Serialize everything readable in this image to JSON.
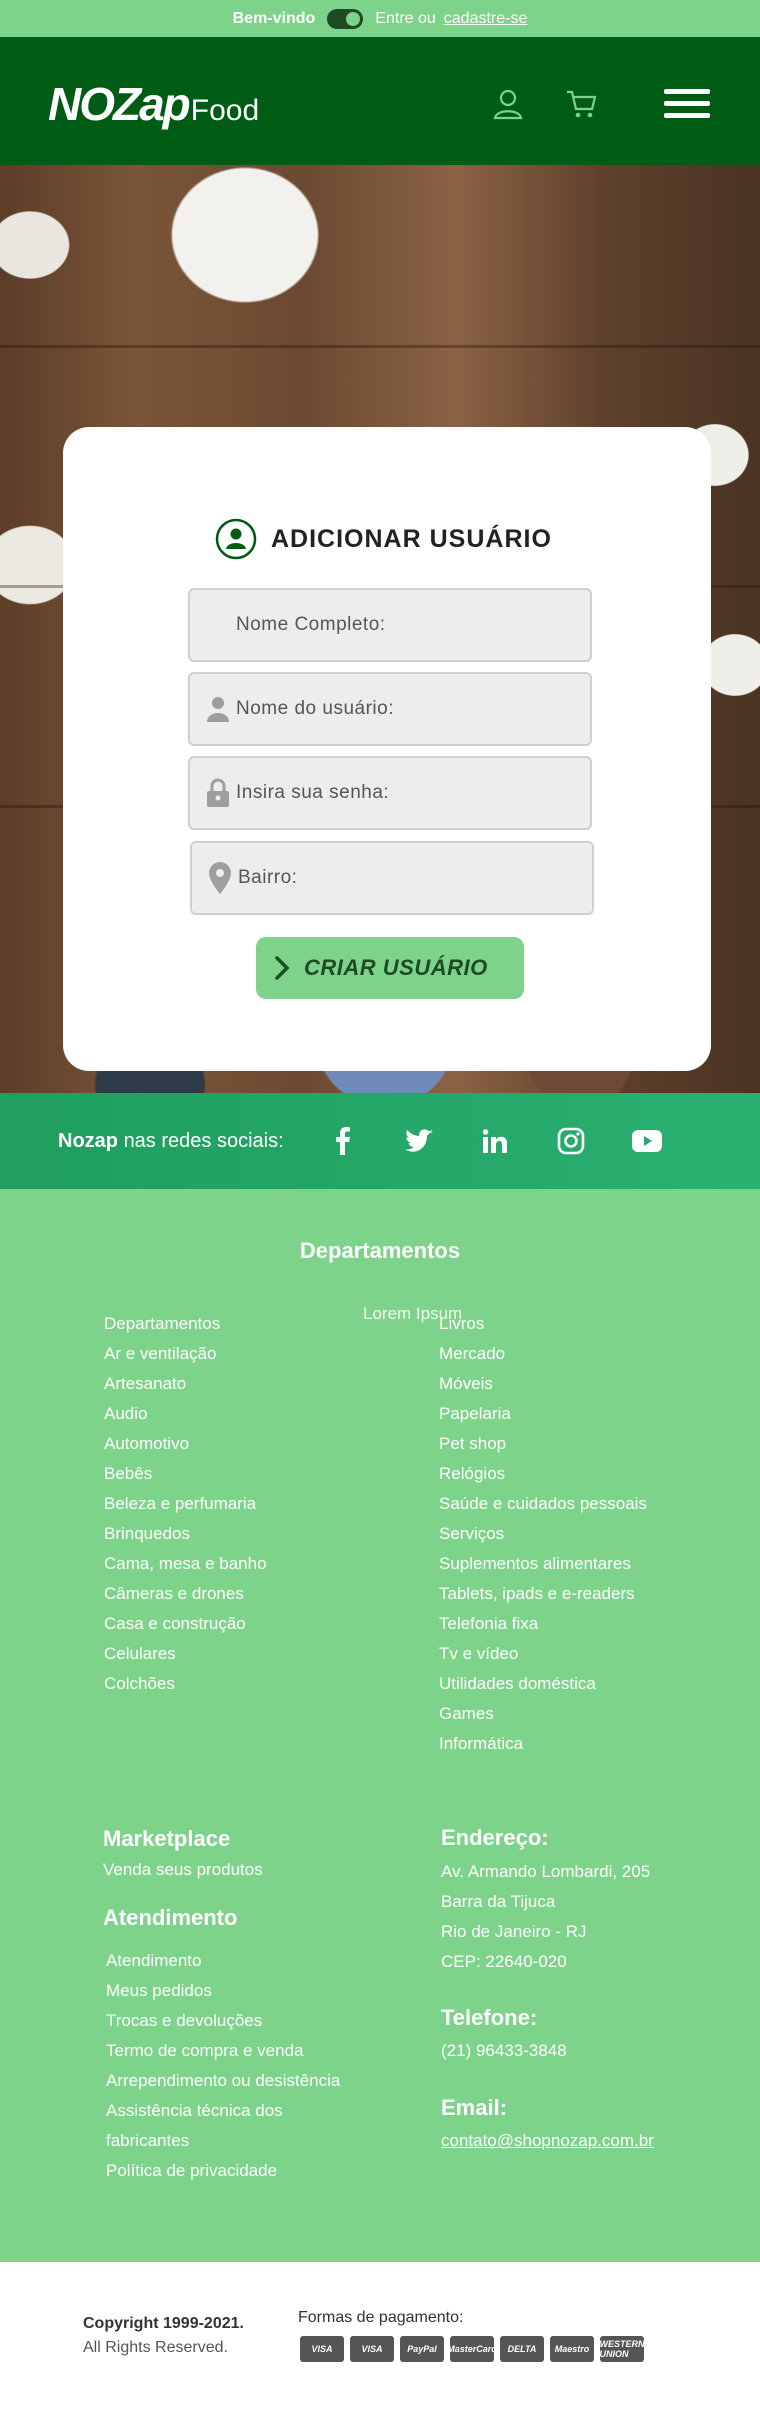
{
  "topbar": {
    "welcome": "Bem-vindo",
    "enter_or": "Entre ou",
    "signup_link": "cadastre-se"
  },
  "header": {
    "logo_main": "NOZap",
    "logo_sub": "Food",
    "icons": [
      "user-icon",
      "cart-icon",
      "menu-icon"
    ],
    "bg_color": "#005c14"
  },
  "form": {
    "title": "ADICIONAR USUÁRIO",
    "fields": [
      {
        "placeholder": "Nome Completo:",
        "icon": "none"
      },
      {
        "placeholder": "Nome do usuário:",
        "icon": "person-icon"
      },
      {
        "placeholder": "Insira sua senha:",
        "icon": "lock-icon"
      },
      {
        "placeholder": "Bairro:",
        "icon": "location-pin-icon"
      }
    ],
    "submit_label": "CRIAR USUÁRIO",
    "accent_color": "#7ed38b"
  },
  "social": {
    "brand": "Nozap",
    "text": "nas redes sociais:",
    "icons": [
      "facebook-icon",
      "twitter-icon",
      "linkedin-icon",
      "instagram-icon",
      "youtube-icon"
    ]
  },
  "footer": {
    "departments_title": "Departamentos",
    "lorem": "Lorem Ipsum",
    "dept_col1": [
      "Departamentos",
      "Ar e ventilação",
      "Artesanato",
      "Audio",
      "Automotivo",
      "Bebês",
      "Beleza e perfumaria",
      "Brinquedos",
      "Cama, mesa e banho",
      "Câmeras e drones",
      "Casa e construção",
      "Celulares",
      "Colchões"
    ],
    "dept_col2": [
      "Livros",
      "Mercado",
      "Móveis",
      "Papelaria",
      "Pet shop",
      "Relógios",
      "Saúde e cuidados pessoais",
      "Serviços",
      "Suplementos alimentares",
      "Tablets, ipads e e-readers",
      "Telefonia fixa",
      "Tv e vídeo",
      "Utilidades doméstica",
      "Games",
      "Informática"
    ],
    "marketplace_title": "Marketplace",
    "marketplace_link": "Venda seus produtos",
    "atendimento_title": "Atendimento",
    "atendimento_links": [
      "Atendimento",
      "Meus pedidos",
      "Trocas e devoluções",
      "Termo de compra e venda",
      "Arrependimento ou desistência",
      "Assistência técnica dos fabricantes",
      "Política de privacidade"
    ],
    "address_title": "Endereço:",
    "address_lines": [
      "Av. Armando Lombardi, 205",
      "Barra da Tijuca",
      "Rio de Janeiro - RJ",
      "CEP: 22640-020"
    ],
    "phone_title": "Telefone:",
    "phone": "(21) 96433-3848",
    "email_title": "Email:",
    "email": "contato@shopnozap.com.br",
    "bg_color": "#7ed38b"
  },
  "bottom": {
    "copyright": "Copyright 1999-2021.",
    "rights": "All Rights Reserved.",
    "payment_title": "Formas de pagamento:",
    "payment_methods": [
      "VISA",
      "VISA",
      "PayPal",
      "MasterCard",
      "DELTA",
      "Maestro",
      "WESTERN UNION"
    ]
  }
}
